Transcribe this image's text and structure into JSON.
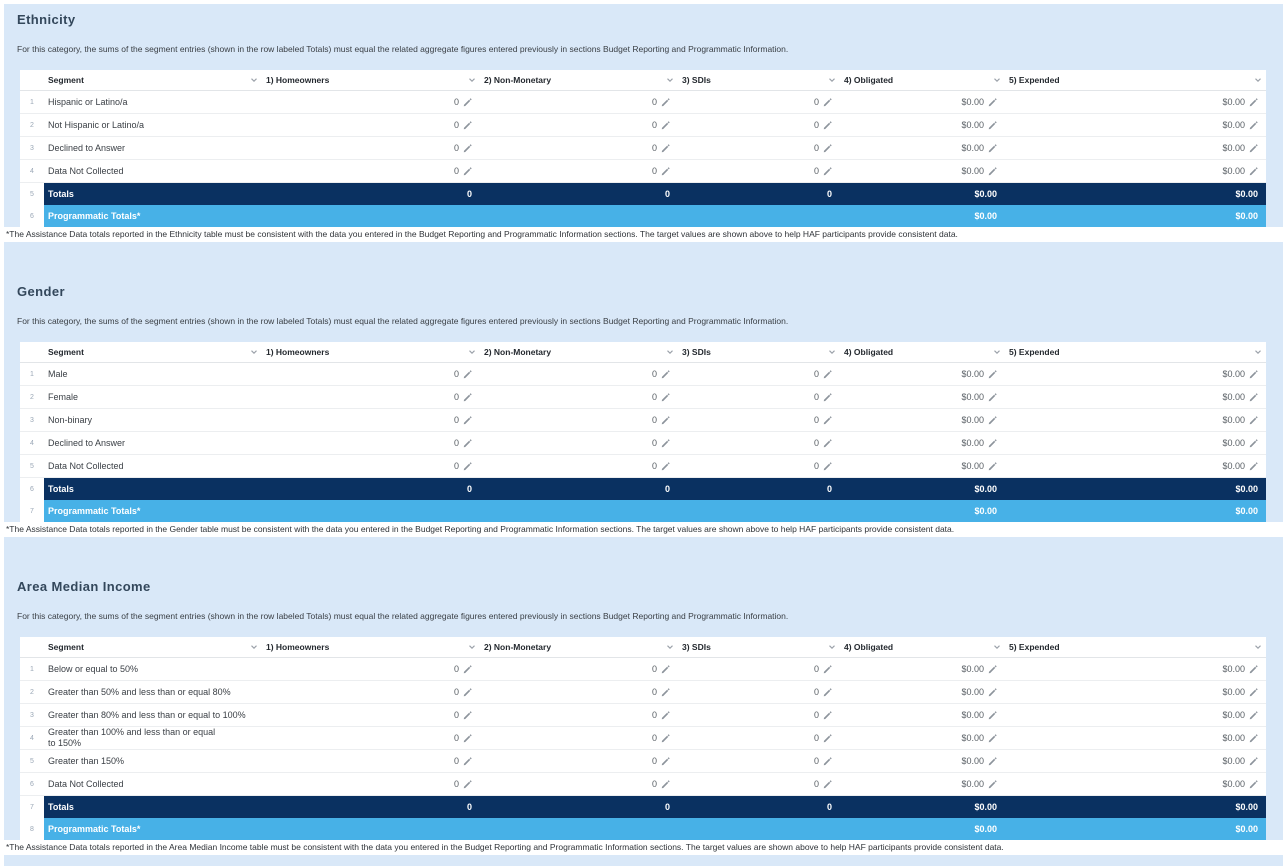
{
  "page": {
    "background_color": "#d9e8f8"
  },
  "colors": {
    "totals_row": "#0a3161",
    "programmatic_row": "#47b1e7",
    "table_background": "#ffffff"
  },
  "icons": {
    "column_menu": "chevron-down-icon",
    "edit_cell": "pencil-icon"
  },
  "columns": [
    {
      "key": "segment",
      "label": "Segment"
    },
    {
      "key": "homeowners",
      "label": "1) Homeowners"
    },
    {
      "key": "non-monetary",
      "label": "2) Non-Monetary"
    },
    {
      "key": "sdis",
      "label": "3) SDIs"
    },
    {
      "key": "obligated",
      "label": "4) Obligated"
    },
    {
      "key": "expended",
      "label": "5) Expended"
    }
  ],
  "sections": [
    {
      "title": "Ethnicity",
      "description": "For this category, the sums of the segment entries (shown in the row labeled Totals) must equal the related aggregate figures entered previously in sections Budget Reporting and Programmatic Information.",
      "footnote": "*The Assistance Data totals reported in the Ethnicity table must be consistent with the data you entered in the Budget Reporting and Programmatic Information sections. The target values are shown above to help HAF participants provide consistent data.",
      "rows": [
        {
          "num": "1",
          "label": "Hispanic or Latino/a",
          "type": "data",
          "values": [
            "0",
            "0",
            "0",
            "$0.00",
            "$0.00"
          ]
        },
        {
          "num": "2",
          "label": "Not Hispanic or Latino/a",
          "type": "data",
          "values": [
            "0",
            "0",
            "0",
            "$0.00",
            "$0.00"
          ]
        },
        {
          "num": "3",
          "label": "Declined to Answer",
          "type": "data",
          "values": [
            "0",
            "0",
            "0",
            "$0.00",
            "$0.00"
          ]
        },
        {
          "num": "4",
          "label": "Data Not Collected",
          "type": "data",
          "values": [
            "0",
            "0",
            "0",
            "$0.00",
            "$0.00"
          ]
        },
        {
          "num": "5",
          "label": "Totals",
          "type": "totals",
          "values": [
            "0",
            "0",
            "0",
            "$0.00",
            "$0.00"
          ]
        },
        {
          "num": "6",
          "label": "Programmatic Totals*",
          "type": "prog",
          "values": [
            "",
            "",
            "",
            "$0.00",
            "$0.00"
          ]
        }
      ]
    },
    {
      "title": "Gender",
      "description": "For this category, the sums of the segment entries (shown in the row labeled Totals) must equal the related aggregate figures entered previously in sections Budget Reporting and Programmatic Information.",
      "footnote": "*The Assistance Data totals reported in the Gender table must be consistent with the data you entered in the Budget Reporting and Programmatic Information sections. The target values are shown above to help HAF participants provide consistent data.",
      "rows": [
        {
          "num": "1",
          "label": "Male",
          "type": "data",
          "values": [
            "0",
            "0",
            "0",
            "$0.00",
            "$0.00"
          ]
        },
        {
          "num": "2",
          "label": "Female",
          "type": "data",
          "values": [
            "0",
            "0",
            "0",
            "$0.00",
            "$0.00"
          ]
        },
        {
          "num": "3",
          "label": "Non-binary",
          "type": "data",
          "values": [
            "0",
            "0",
            "0",
            "$0.00",
            "$0.00"
          ]
        },
        {
          "num": "4",
          "label": "Declined to Answer",
          "type": "data",
          "values": [
            "0",
            "0",
            "0",
            "$0.00",
            "$0.00"
          ]
        },
        {
          "num": "5",
          "label": "Data Not Collected",
          "type": "data",
          "values": [
            "0",
            "0",
            "0",
            "$0.00",
            "$0.00"
          ]
        },
        {
          "num": "6",
          "label": "Totals",
          "type": "totals",
          "values": [
            "0",
            "0",
            "0",
            "$0.00",
            "$0.00"
          ]
        },
        {
          "num": "7",
          "label": "Programmatic Totals*",
          "type": "prog",
          "values": [
            "",
            "",
            "",
            "$0.00",
            "$0.00"
          ]
        }
      ]
    },
    {
      "title": "Area Median Income",
      "description": "For this category, the sums of the segment entries (shown in the row labeled Totals) must equal the related aggregate figures entered previously in sections Budget Reporting and Programmatic Information.",
      "footnote": "*The Assistance Data totals reported in the Area Median Income table must be consistent with the data you entered in the Budget Reporting and Programmatic Information sections. The target values are shown above to help HAF participants provide consistent data.",
      "rows": [
        {
          "num": "1",
          "label": "Below or equal to 50%",
          "type": "data",
          "values": [
            "0",
            "0",
            "0",
            "$0.00",
            "$0.00"
          ]
        },
        {
          "num": "2",
          "label": "Greater than 50% and less than or equal 80%",
          "type": "data",
          "values": [
            "0",
            "0",
            "0",
            "$0.00",
            "$0.00"
          ]
        },
        {
          "num": "3",
          "label": "Greater than 80% and less than or equal to 100%",
          "type": "data",
          "values": [
            "0",
            "0",
            "0",
            "$0.00",
            "$0.00"
          ]
        },
        {
          "num": "4",
          "label": "Greater than 100% and less than or equal to 150%",
          "type": "data",
          "wrap": true,
          "values": [
            "0",
            "0",
            "0",
            "$0.00",
            "$0.00"
          ]
        },
        {
          "num": "5",
          "label": "Greater than 150%",
          "type": "data",
          "values": [
            "0",
            "0",
            "0",
            "$0.00",
            "$0.00"
          ]
        },
        {
          "num": "6",
          "label": "Data Not Collected",
          "type": "data",
          "values": [
            "0",
            "0",
            "0",
            "$0.00",
            "$0.00"
          ]
        },
        {
          "num": "7",
          "label": "Totals",
          "type": "totals",
          "values": [
            "0",
            "0",
            "0",
            "$0.00",
            "$0.00"
          ]
        },
        {
          "num": "8",
          "label": "Programmatic Totals*",
          "type": "prog",
          "values": [
            "",
            "",
            "",
            "$0.00",
            "$0.00"
          ]
        }
      ]
    }
  ]
}
